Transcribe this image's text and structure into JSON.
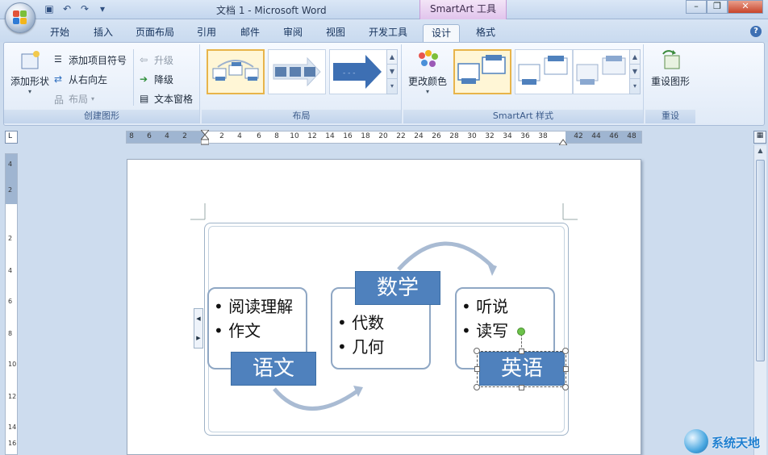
{
  "window": {
    "title": "文档 1 - Microsoft Word",
    "context_tab_group": "SmartArt 工具"
  },
  "quick_access": {
    "icons": [
      "save-icon",
      "undo-icon",
      "redo-icon",
      "customize-icon"
    ]
  },
  "tabs": [
    {
      "label": "开始",
      "active": false
    },
    {
      "label": "插入",
      "active": false
    },
    {
      "label": "页面布局",
      "active": false
    },
    {
      "label": "引用",
      "active": false
    },
    {
      "label": "邮件",
      "active": false
    },
    {
      "label": "审阅",
      "active": false
    },
    {
      "label": "视图",
      "active": false
    },
    {
      "label": "开发工具",
      "active": false
    },
    {
      "label": "设计",
      "active": true
    },
    {
      "label": "格式",
      "active": false
    }
  ],
  "ribbon": {
    "create_graphic": {
      "add_shape": "添加形状",
      "add_bullet": "添加项目符号",
      "right_to_left": "从右向左",
      "layout": "布局",
      "promote": "升级",
      "demote": "降级",
      "text_pane": "文本窗格",
      "group_label": "创建图形"
    },
    "layouts": {
      "group_label": "布局"
    },
    "styles": {
      "change_colors": "更改颜色",
      "group_label": "SmartArt 样式"
    },
    "reset": {
      "reset_graphic": "重设图形",
      "group_label": "重设"
    }
  },
  "ruler": {
    "ticks": [
      "8",
      "6",
      "4",
      "2",
      "2",
      "4",
      "6",
      "8",
      "10",
      "12",
      "14",
      "16",
      "18",
      "20",
      "22",
      "24",
      "26",
      "28",
      "30",
      "32",
      "34",
      "36",
      "38",
      "42",
      "44",
      "46",
      "48"
    ],
    "vticks": [
      "4",
      "2",
      "2",
      "4",
      "6",
      "8",
      "10",
      "12",
      "14",
      "16"
    ]
  },
  "smartart": {
    "nodes": [
      {
        "title": "语文",
        "bullets": [
          "阅读理解",
          "作文"
        ]
      },
      {
        "title": "数学",
        "bullets": [
          "代数",
          "几何"
        ]
      },
      {
        "title": "英语",
        "bullets": [
          "听说",
          "读写"
        ]
      }
    ],
    "colors": {
      "title_fill": "#4f81bd",
      "box_border": "#8fa7c4",
      "arrow": "#a9bbd3"
    }
  },
  "watermark": {
    "text": "系统天地"
  }
}
